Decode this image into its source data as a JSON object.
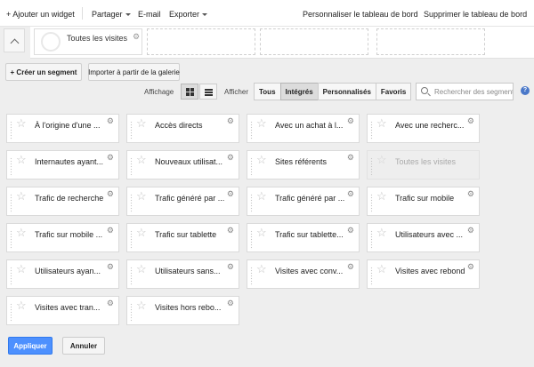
{
  "toolbar": {
    "add_widget": "+ Ajouter un widget",
    "share": "Partager",
    "email": "E-mail",
    "export": "Exporter",
    "customize": "Personnaliser le tableau de bord",
    "delete": "Supprimer le tableau de bord"
  },
  "segment_bar": {
    "active_segment": "Toutes les visites"
  },
  "actions": {
    "create_segment": "+ Créer un segment",
    "import_gallery": "Importer à partir de la galerie"
  },
  "view": {
    "display_label": "Affichage",
    "filter_label": "Afficher",
    "filters": [
      "Tous",
      "Intégrés",
      "Personnalisés",
      "Favoris"
    ],
    "active_filter": "Intégrés",
    "search_placeholder": "Rechercher des segments",
    "help": "?"
  },
  "segments": [
    {
      "label": "À l'origine d'une ...",
      "disabled": false
    },
    {
      "label": "Accès directs",
      "disabled": false
    },
    {
      "label": "Avec un achat à l...",
      "disabled": false
    },
    {
      "label": "Avec une recherc...",
      "disabled": false
    },
    {
      "label": "Internautes ayant...",
      "disabled": false
    },
    {
      "label": "Nouveaux utilisat...",
      "disabled": false
    },
    {
      "label": "Sites référents",
      "disabled": false
    },
    {
      "label": "Toutes les visites",
      "disabled": true
    },
    {
      "label": "Trafic de recherche",
      "disabled": false
    },
    {
      "label": "Trafic généré par ...",
      "disabled": false
    },
    {
      "label": "Trafic généré par ...",
      "disabled": false
    },
    {
      "label": "Trafic sur mobile",
      "disabled": false
    },
    {
      "label": "Trafic sur mobile ...",
      "disabled": false
    },
    {
      "label": "Trafic sur tablette",
      "disabled": false
    },
    {
      "label": "Trafic sur tablette...",
      "disabled": false
    },
    {
      "label": "Utilisateurs avec ...",
      "disabled": false
    },
    {
      "label": "Utilisateurs ayan...",
      "disabled": false
    },
    {
      "label": "Utilisateurs sans...",
      "disabled": false
    },
    {
      "label": "Visites avec conv...",
      "disabled": false
    },
    {
      "label": "Visites avec rebond",
      "disabled": false
    },
    {
      "label": "Visites avec tran...",
      "disabled": false
    },
    {
      "label": "Visites hors rebo...",
      "disabled": false
    }
  ],
  "footer": {
    "apply": "Appliquer",
    "cancel": "Annuler"
  },
  "colors": {
    "accent": "#4d90fe",
    "panel_bg": "#eeeeee"
  }
}
